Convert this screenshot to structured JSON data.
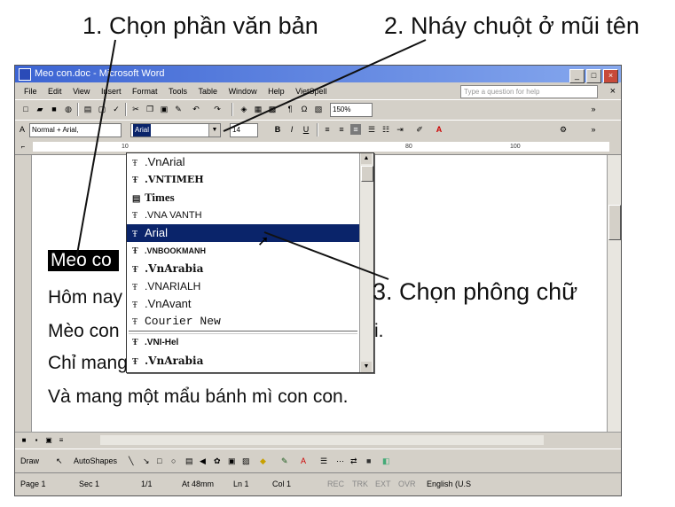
{
  "callouts": {
    "step1": "1. Chọn phần văn bản",
    "step2": "2. Nháy chuột ở mũi tên",
    "step3": "3. Chọn phông chữ"
  },
  "window": {
    "title": "Meo con.doc - Microsoft Word",
    "help_placeholder": "Type a question for help"
  },
  "menu": [
    "File",
    "Edit",
    "View",
    "Insert",
    "Format",
    "Tools",
    "Table",
    "Window",
    "Help",
    "VietSpell"
  ],
  "toolbar": {
    "zoom": "150%",
    "style": "Normal + Arial,",
    "font_value": "Arial",
    "font_size": "14",
    "bold": "B",
    "italic": "I",
    "underline": "U"
  },
  "ruler": {
    "left_mark": "10",
    "mark_80": "80",
    "mark_100": "100"
  },
  "document": {
    "lines": [
      "Meo co",
      "Hôm nay",
      "Mèo con",
      "Chỉ mang một cái bút chì.",
      "Và mang một mẩu bánh mì con con."
    ],
    "line3_tail": "i."
  },
  "font_dropdown": {
    "items": [
      ".VnArial",
      ".VNTIMEH",
      "Times",
      ".VNA VANTH",
      "Arial",
      ".VNBOOKMANH",
      ".VnArabia",
      ".VNARIALH",
      ".VnAvant",
      "Courier New",
      ".VNI-Hel",
      ".VnArabia"
    ],
    "selected_index": 4
  },
  "drawing": {
    "draw": "Draw",
    "autoshapes": "AutoShapes"
  },
  "status": {
    "page": "Page 1",
    "sec": "Sec 1",
    "pages": "1/1",
    "at": "At 48mm",
    "ln": "Ln 1",
    "col": "Col 1",
    "rec": "REC",
    "trk": "TRK",
    "ext": "EXT",
    "ovr": "OVR",
    "lang": "English (U.S"
  },
  "colors": {
    "title_bar": "#3c64d3",
    "selection": "#0a246a",
    "chrome": "#d4d0c8"
  }
}
